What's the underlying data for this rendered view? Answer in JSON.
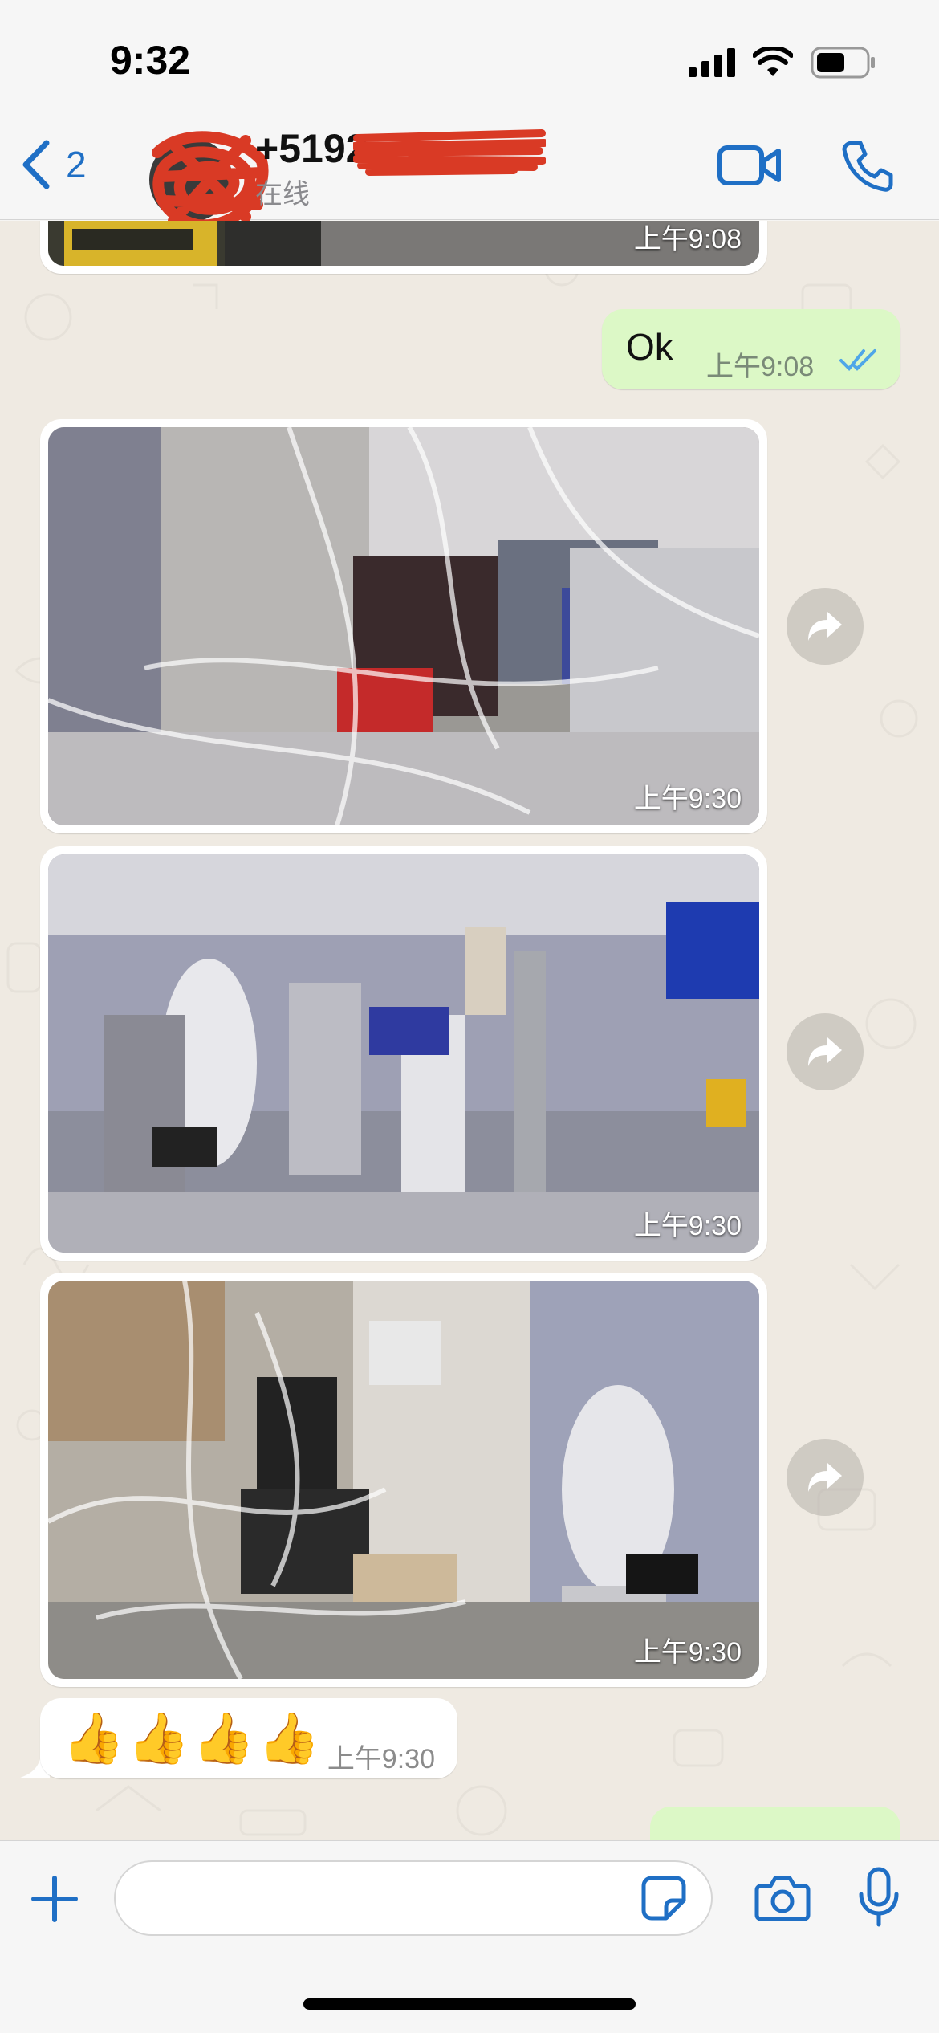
{
  "status_bar": {
    "time": "9:32"
  },
  "header": {
    "back_count": "2",
    "contact_name": "+5192",
    "contact_status": "在线"
  },
  "chat": {
    "messages": [
      {
        "type": "image",
        "direction": "incoming",
        "time": "上午9:08"
      },
      {
        "type": "text",
        "direction": "outgoing",
        "text": "Ok",
        "time": "上午9:08",
        "status": "read"
      },
      {
        "type": "image",
        "direction": "incoming",
        "time": "上午9:30"
      },
      {
        "type": "image",
        "direction": "incoming",
        "time": "上午9:30"
      },
      {
        "type": "image",
        "direction": "incoming",
        "time": "上午9:30"
      },
      {
        "type": "text",
        "direction": "incoming",
        "text": "👍👍👍👍",
        "time": "上午9:30"
      }
    ]
  },
  "colors": {
    "accent": "#1f6fc5",
    "outgoing_bubble": "#dcf8c6",
    "incoming_bubble": "#ffffff",
    "read_ticks": "#4fa6e8",
    "redaction": "#d93a25"
  },
  "icons": [
    "chevron-left-icon",
    "video-call-icon",
    "phone-icon",
    "forward-icon",
    "plus-icon",
    "sticker-icon",
    "camera-icon",
    "microphone-icon",
    "signal-icon",
    "wifi-icon",
    "battery-icon"
  ]
}
